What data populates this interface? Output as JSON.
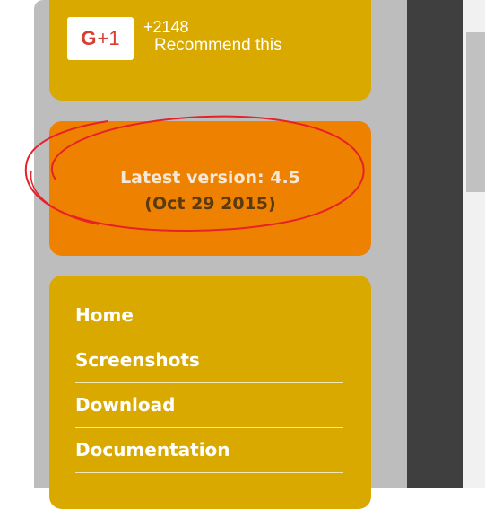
{
  "social": {
    "button_label": "G+1",
    "count": "+2148",
    "text": "Recommend this"
  },
  "version": {
    "line1": "Latest version: 4.5",
    "line2": "(Oct 29 2015)"
  },
  "menu": {
    "items": [
      {
        "label": "Home"
      },
      {
        "label": "Screenshots"
      },
      {
        "label": "Download"
      },
      {
        "label": "Documentation"
      }
    ]
  },
  "colors": {
    "gold": "#d9a900",
    "orange": "#ee8200",
    "gray_column": "#bdbdbd",
    "dark_strip": "#3f3f3f",
    "annotation_red": "#e8202a",
    "gplus_red": "#d73d32"
  }
}
